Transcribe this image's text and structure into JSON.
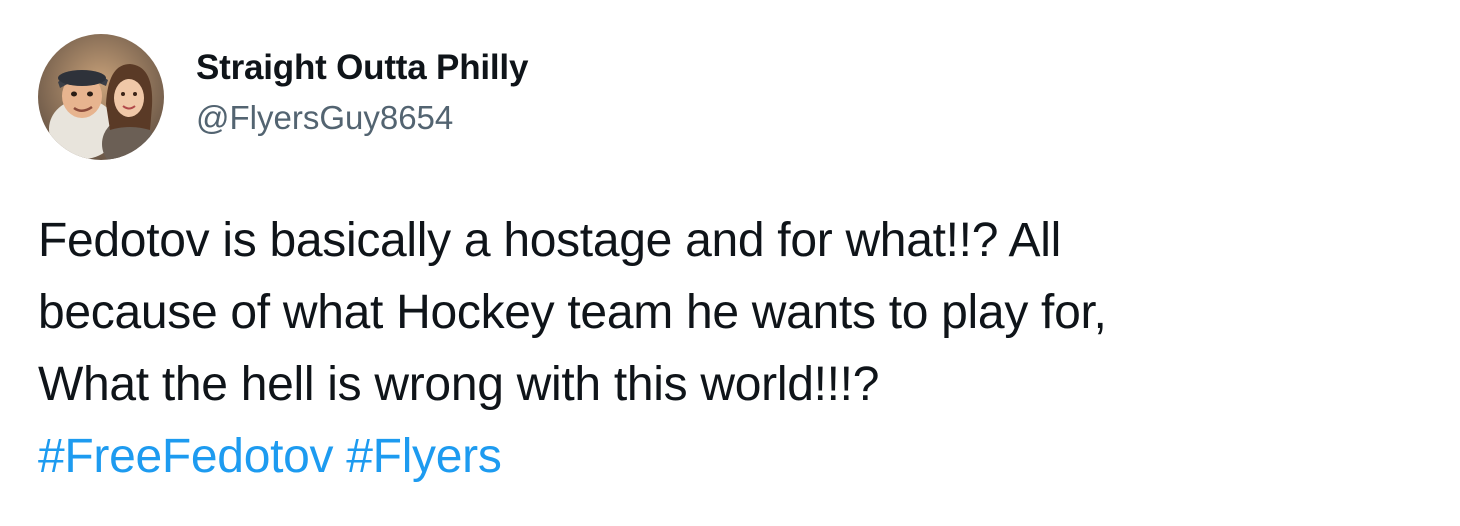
{
  "author": {
    "display_name": "Straight Outta Philly",
    "handle": "@FlyersGuy8654"
  },
  "tweet": {
    "lines": [
      "Fedotov is basically a hostage and for what!!? All",
      "because of what Hockey team he wants to play for,",
      "What the hell is wrong with this world!!!?"
    ],
    "hashtags": [
      "#FreeFedotov",
      "#Flyers"
    ]
  },
  "colors": {
    "text": "#0f1419",
    "secondary": "#536471",
    "hashtag": "#1d9bf0"
  }
}
